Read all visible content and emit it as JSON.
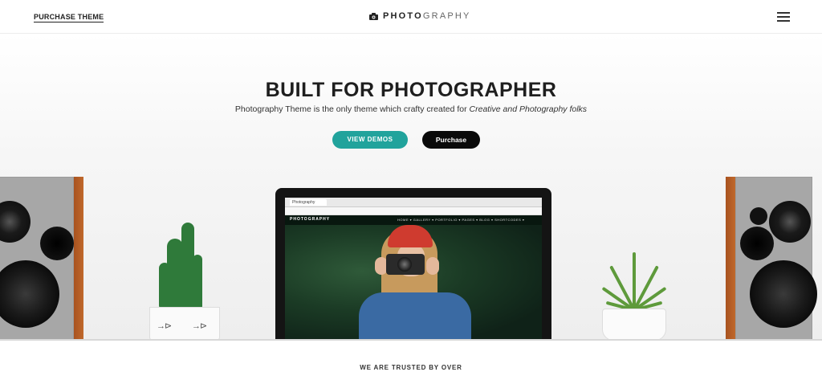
{
  "header": {
    "purchase_link": "Purchase Theme",
    "logo_bold": "PHOTO",
    "logo_light": "GRAPHY",
    "logo_icon": "camera-icon",
    "menu_icon": "hamburger-icon"
  },
  "hero": {
    "title": "BUILT FOR PHOTOGRAPHER",
    "subtitle_plain": "Photography Theme is the only theme which crafty created for ",
    "subtitle_italic": "Creative and Photography folks",
    "btn_demos": "VIEW DEMOS",
    "btn_purchase": "Purchase",
    "accent_color": "#21a39c",
    "dark_color": "#0a0a0a"
  },
  "laptop_screen": {
    "site_logo": "PHOTOGRAPHY",
    "nav_links": "HOME ▾   GALLERY ▾   PORTFOLIO ▾   PAGES ▾   BLOG ▾   SHORTCODES ▾"
  },
  "trusted": {
    "label": "WE ARE TRUSTED BY OVER"
  }
}
